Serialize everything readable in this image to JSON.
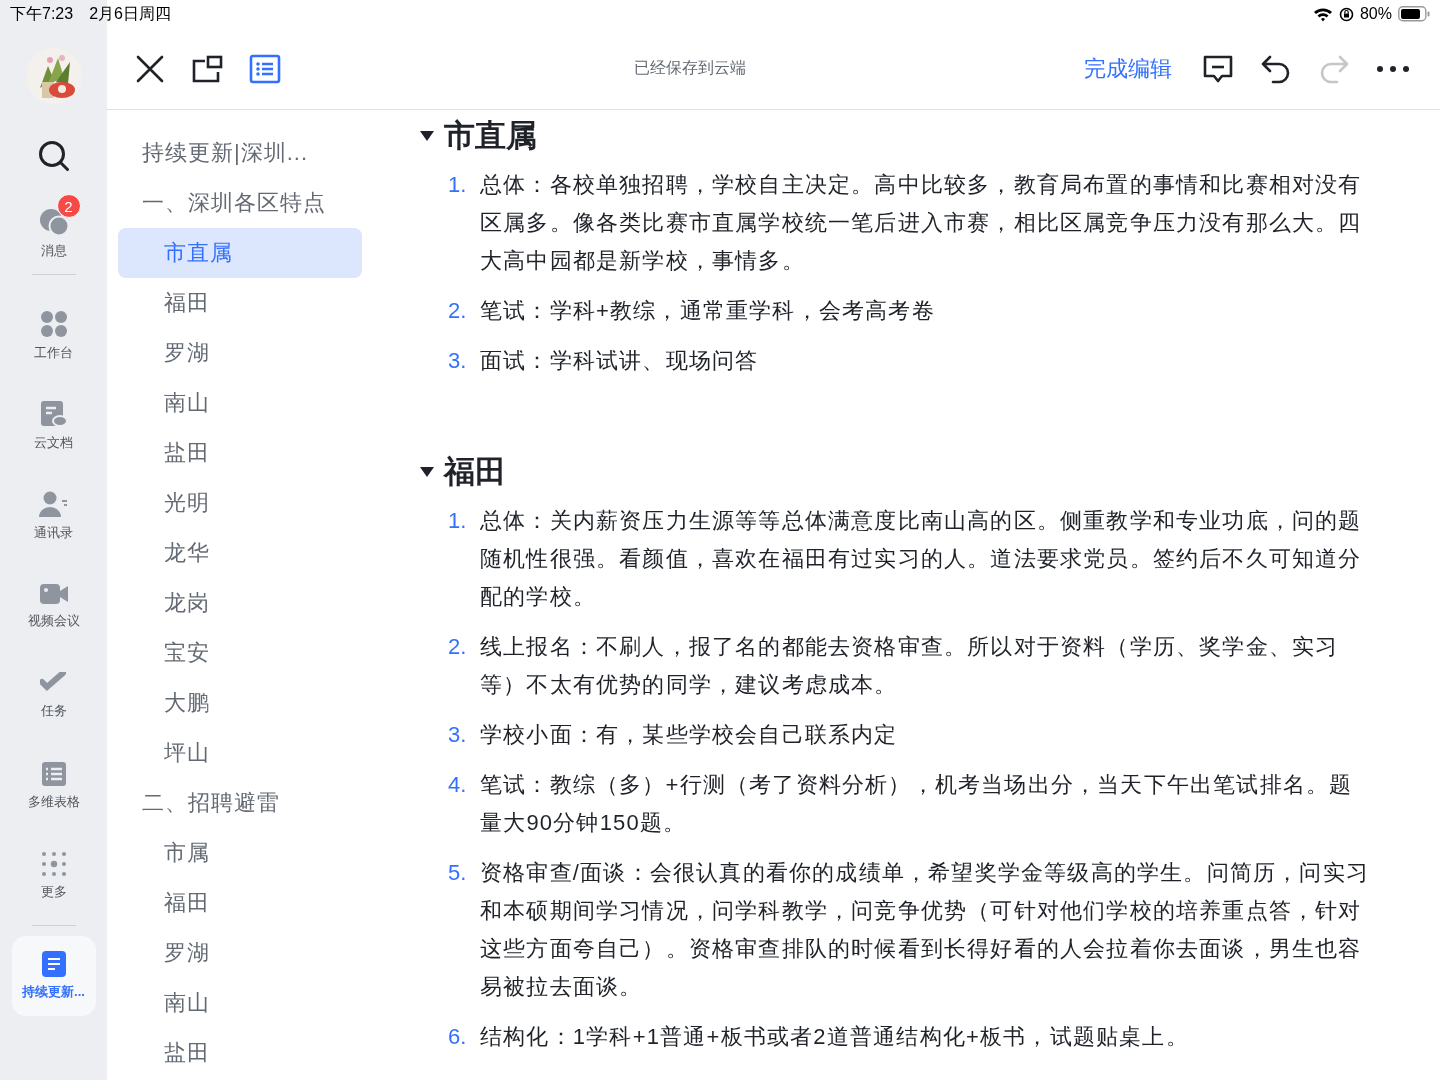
{
  "status_bar": {
    "time": "下午7:23",
    "date": "2月6日周四",
    "battery": "80%"
  },
  "rail": {
    "items": [
      {
        "kind": "search",
        "selected": false
      },
      {
        "kind": "chat",
        "label": "消息",
        "badge": "2",
        "selected": false
      },
      {
        "kind": "grid",
        "label": "工作台",
        "selected": false
      },
      {
        "kind": "doc",
        "label": "云文档",
        "selected": false
      },
      {
        "kind": "contacts",
        "label": "通讯录",
        "selected": false
      },
      {
        "kind": "video",
        "label": "视频会议",
        "selected": false
      },
      {
        "kind": "task",
        "label": "任务",
        "selected": false
      },
      {
        "kind": "table",
        "label": "多维表格",
        "selected": false
      },
      {
        "kind": "more",
        "label": "更多",
        "selected": false
      },
      {
        "kind": "page",
        "label": "持续更新...",
        "selected": true
      }
    ]
  },
  "toolbar": {
    "outline_toggle": {
      "on": true
    },
    "save_status": "已经保存到云端",
    "done_button": "完成编辑",
    "redo": {
      "disabled": true
    }
  },
  "outline": {
    "items": [
      {
        "label": "持续更新|深圳...",
        "selected": false
      },
      {
        "label": "一、深圳各区特点",
        "selected": false,
        "children": [
          {
            "label": "市直属",
            "selected": true
          },
          {
            "label": "福田",
            "selected": false
          },
          {
            "label": "罗湖",
            "selected": false
          },
          {
            "label": "南山",
            "selected": false
          },
          {
            "label": "盐田",
            "selected": false
          },
          {
            "label": "光明",
            "selected": false
          },
          {
            "label": "龙华",
            "selected": false
          },
          {
            "label": "龙岗",
            "selected": false
          },
          {
            "label": "宝安",
            "selected": false
          },
          {
            "label": "大鹏",
            "selected": false
          },
          {
            "label": "坪山",
            "selected": false
          }
        ]
      },
      {
        "label": "二、招聘避雷",
        "selected": false,
        "children": [
          {
            "label": "市属",
            "selected": false
          },
          {
            "label": "福田",
            "selected": false
          },
          {
            "label": "罗湖",
            "selected": false
          },
          {
            "label": "南山",
            "selected": false
          },
          {
            "label": "盐田",
            "selected": false
          }
        ]
      }
    ]
  },
  "document": {
    "sections": [
      {
        "heading": "市直属",
        "expanded": true,
        "items": [
          {
            "number": "1.",
            "text": "总体：各校单独招聘，学校自主决定。高中比较多，教育局布置的事情和比赛相对没有区属多。像各类比赛市直属学校统一笔后进入市赛，相比区属竞争压力没有那么大。四大高中园都是新学校，事情多。"
          },
          {
            "number": "2.",
            "text": "笔试：学科+教综，通常重学科，会考高考卷"
          },
          {
            "number": "3.",
            "text": "面试：学科试讲、现场问答"
          }
        ]
      },
      {
        "heading": "福田",
        "expanded": true,
        "items": [
          {
            "number": "1.",
            "text": "总体：关内薪资压力生源等等总体满意度比南山高的区。侧重教学和专业功底，问的题随机性很强。看颜值，喜欢在福田有过实习的人。道法要求党员。签约后不久可知道分配的学校。"
          },
          {
            "number": "2.",
            "text": "线上报名：不刷人，报了名的都能去资格审查。所以对于资料（学历、奖学金、实习等）不太有优势的同学，建议考虑成本。"
          },
          {
            "number": "3.",
            "text": "学校小面：有，某些学校会自己联系内定"
          },
          {
            "number": "4.",
            "text": "笔试：教综（多）+行测（考了资料分析），机考当场出分，当天下午出笔试排名。题量大90分钟150题。"
          },
          {
            "number": "5.",
            "text": "资格审查/面谈：会很认真的看你的成绩单，希望奖学金等级高的学生。问简历，问实习和本硕期间学习情况，问学科教学，问竞争优势（可针对他们学校的培养重点答，针对这些方面夸自己）。资格审查排队的时候看到长得好看的人会拉着你去面谈，男生也容易被拉去面谈。"
          },
          {
            "number": "6.",
            "text": "结构化：1学科+1普通+板书或者2道普通结构化+板书，试题贴桌上。"
          }
        ]
      }
    ]
  }
}
